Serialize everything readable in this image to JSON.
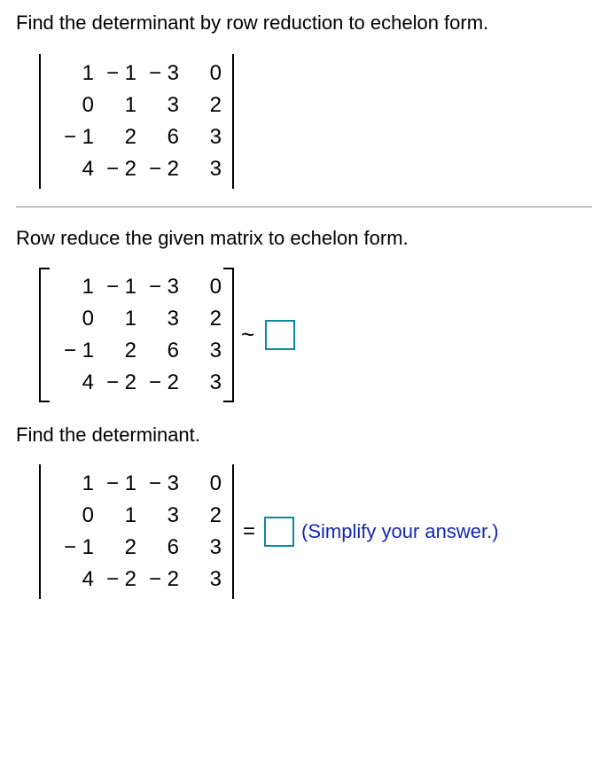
{
  "prompt": "Find the determinant by row reduction to echelon form.",
  "matrix": {
    "r1c1": "1",
    "r1c2": "− 1",
    "r1c3": "− 3",
    "r1c4": "0",
    "r2c1": "0",
    "r2c2": "1",
    "r2c3": "3",
    "r2c4": "2",
    "r3c1": "− 1",
    "r3c2": "2",
    "r3c3": "6",
    "r3c4": "3",
    "r4c1": "4",
    "r4c2": "− 2",
    "r4c3": "− 2",
    "r4c4": "3"
  },
  "step1_text": "Row reduce the given matrix to echelon form.",
  "tilde": "~",
  "step2_text": "Find the determinant.",
  "equals": "=",
  "simplify_note": "(Simplify your answer.)"
}
